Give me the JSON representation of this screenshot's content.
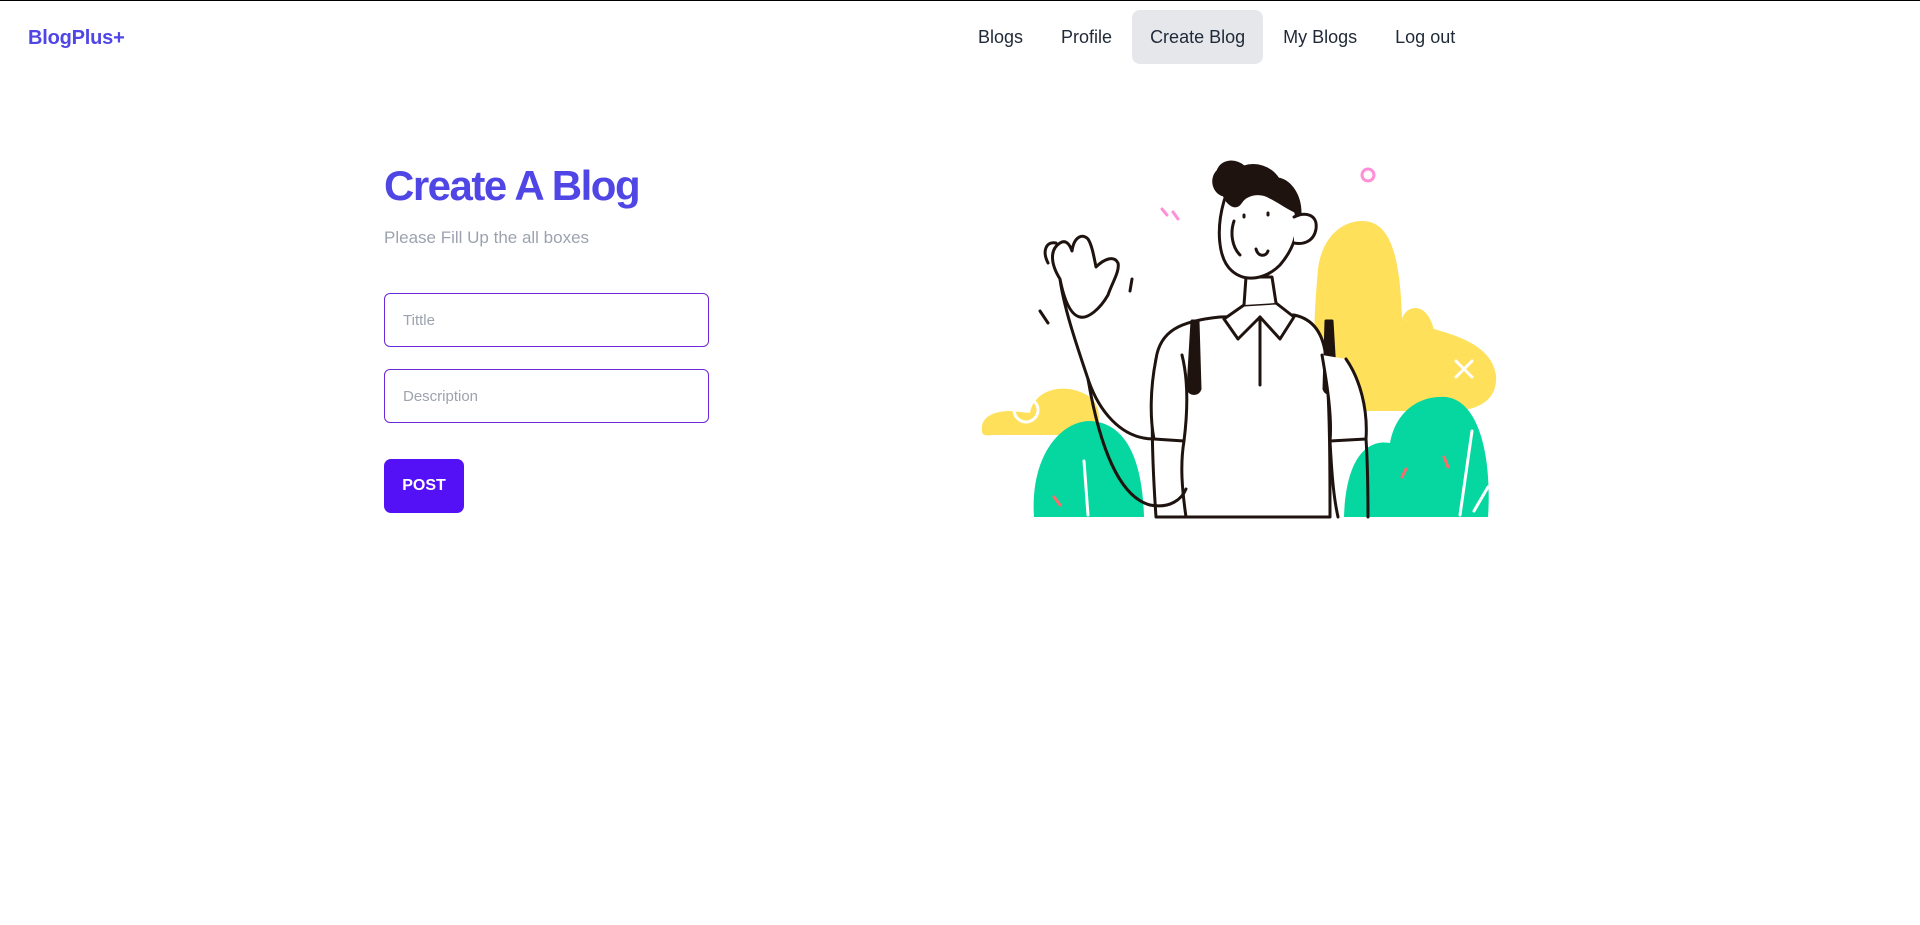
{
  "navbar": {
    "brand": "BlogPlus+",
    "links": [
      {
        "label": "Blogs",
        "active": false
      },
      {
        "label": "Profile",
        "active": false
      },
      {
        "label": "Create Blog",
        "active": true
      },
      {
        "label": "My Blogs",
        "active": false
      },
      {
        "label": "Log out",
        "active": false
      }
    ]
  },
  "form": {
    "title": "Create A Blog",
    "subtitle": "Please Fill Up the all boxes",
    "title_field": {
      "value": "",
      "placeholder": "Tittle"
    },
    "description_field": {
      "value": "",
      "placeholder": "Description"
    },
    "submit_label": "POST"
  },
  "illustration": {
    "subject": "man-waving-illustration",
    "colors": {
      "cloud": "#ffe05a",
      "bush": "#06d6a0",
      "outline": "#1f130f",
      "confetti_pink": "#ff8fd8",
      "confetti_red": "#ff6b6b"
    }
  },
  "colors": {
    "brand": "#4f46e5",
    "accent": "#5511f5",
    "input_border": "#6d28d9",
    "active_nav_bg": "#e5e7eb",
    "muted_text": "#9ca3af"
  }
}
